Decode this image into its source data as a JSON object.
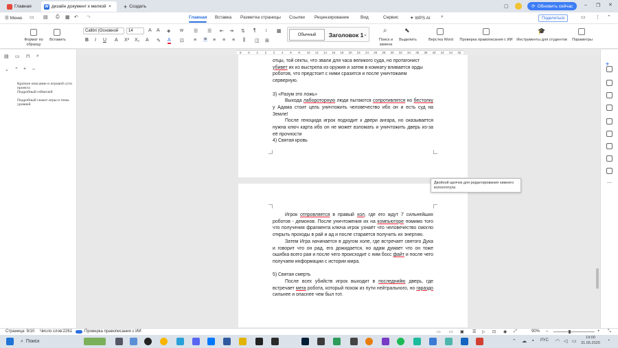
{
  "tabs": [
    {
      "label": "Главная"
    },
    {
      "label": "дизайн документ к мелкой..."
    },
    {
      "label": "Создать"
    }
  ],
  "update_button": "Обновить сейчас",
  "menu": {
    "main_menu": "Меню",
    "items": [
      "Главная",
      "Вставка",
      "Разметка страницы",
      "Ссылки",
      "Рецензирование",
      "Вид",
      "Сервис",
      "WPS AI"
    ],
    "share": "Поделиться"
  },
  "ribbon": {
    "format_painter": "Формат по образцу",
    "paste": "Вставить",
    "font_family": "Calibri (Основной",
    "font_size": "14",
    "style_normal": "Обычный",
    "style_heading": "Заголовок 1",
    "find_replace": "Поиск и замена",
    "select": "Выделить",
    "word_ribbon": "Верстка Word",
    "spellcheck": "Проверка правописания с ИИ",
    "ai_tools": "Инструменты для студентов",
    "params": "Параметры"
  },
  "ruler": [
    "8",
    "6",
    "4",
    "2",
    "2",
    "4",
    "6",
    "8",
    "10",
    "12",
    "14",
    "16",
    "18",
    "20",
    "22",
    "24",
    "26",
    "28",
    "30",
    "32",
    "34",
    "36",
    "38",
    "40",
    "42",
    "44",
    "46"
  ],
  "outline": [
    "Краткое описание и игровой сути проекта",
    "Подробный геймплей",
    "Подробный сюжет игры и темы уровней"
  ],
  "page1": {
    "p1_l1": "отцы, той секты, что звали для часа великого суда, но протагонист",
    "p1_l2a": "",
    "p1_l2u": "убивет",
    "p1_l2b": " их из выстрела из оружия и затем в комнату вливается орды",
    "p1_l3": "роботов, что предстоит с ними сразится и после уничтожаем",
    "p1_l4": "серверную.",
    "h3": "3) «Разум это ложь»",
    "p2_a": "Выхода ",
    "p2_u1": "лабороторную",
    "p2_b": " люди пытаются ",
    "p2_u2": "сопротивлятся",
    "p2_c": " но ",
    "p2_u3": "бестолку",
    "p2_d": " у Адама стоит цель уничтожить человечество ибо он и есть суд на Земле!",
    "p3": "После геноцида игрок подходит к двери ангара, но оказывается нужна ключ карта ибо он не может взломать и уничтожить дверь из-за её прочности",
    "h4": "4) Святая кровь"
  },
  "tooltip": "Двойной щелчок для редактирования нижнего колонтитула",
  "page2": {
    "p1_a": "Игрок ",
    "p1_u1": "отпровляется",
    "p1_b": " в правый ",
    "p1_u2": "хол",
    "p1_c": ", где его ждут 7 сильнейших роботов - демонов. После уничтожения их на ",
    "p1_u3": "компьюторе",
    "p1_d": " помимо того что получения фрагмента ключа игрок узнаёт что человечество смогло открыть проходы в рай и ад и после старается получить их энергию.",
    "p2_a": "Затем Игра начинается в другом холе, где встречает святого Дука и говорит что он рад, его дожидается, но адам думает что он тоже ошибка всего рая и после чего происходит с ним босс ",
    "p2_u": "файт",
    "p2_b": " и после чего получаем информации с истории мира.",
    "h5": "5) Святая смерть",
    "p3_a": "После всех убийств игрок выходит в ",
    "p3_u1": "последнийю",
    "p3_b": " дверь, где встречает ",
    "p3_u2": "мега",
    "p3_c": " робота, который похож из пути нейтрального, но ",
    "p3_u3": "гараздо",
    "p3_d": " сильнее и опаснее чем был тот."
  },
  "status": {
    "page": "Страница: 9/10",
    "words": "Число слов:2261",
    "spell": "Проверка правописания с ИИ",
    "zoom": "90%"
  },
  "taskbar": {
    "search": "Поиск",
    "lang": "РУС",
    "time": "19:00",
    "date": "31.05.2025"
  }
}
